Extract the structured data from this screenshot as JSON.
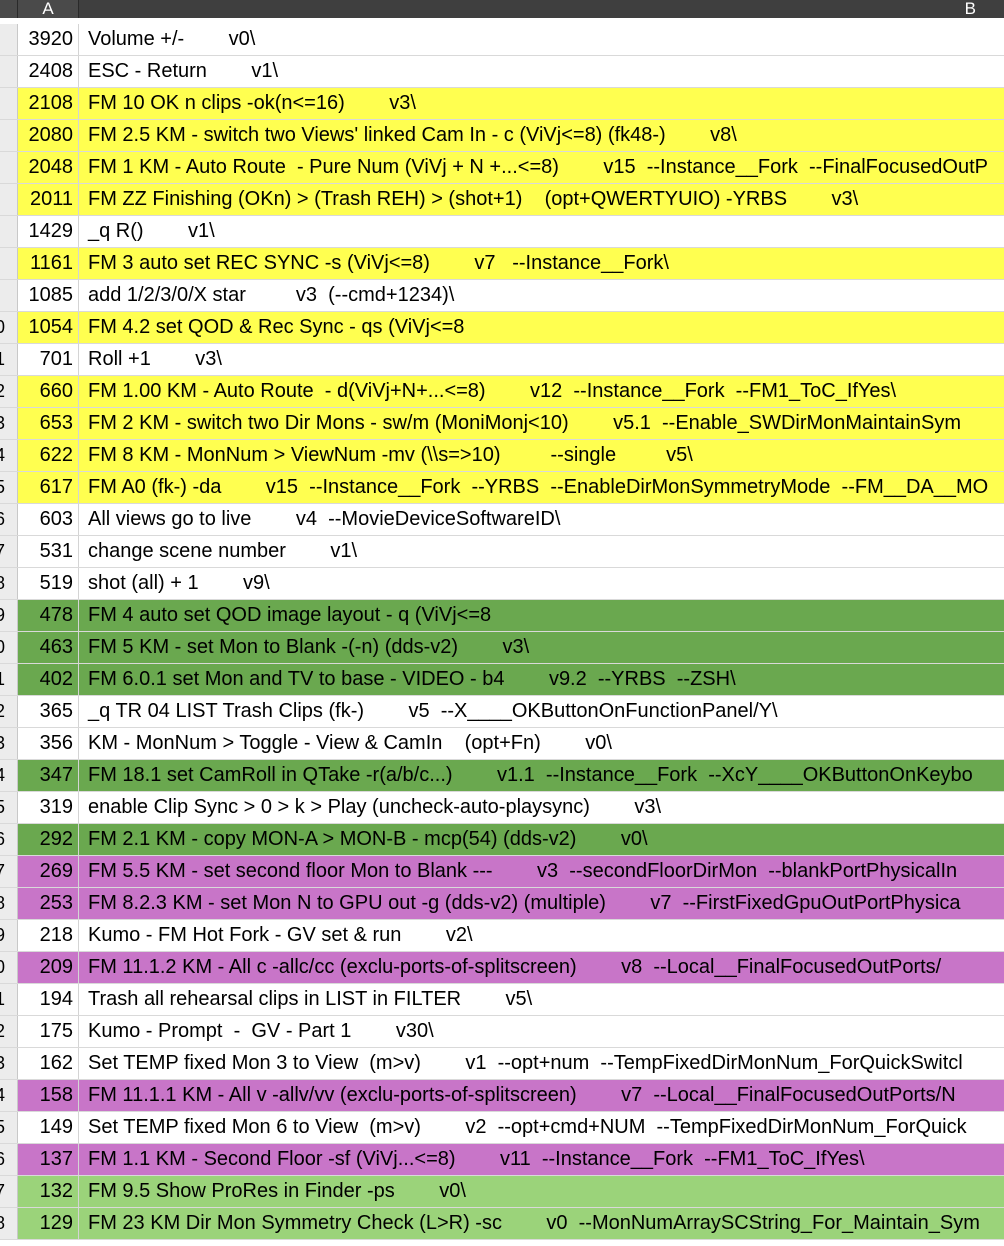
{
  "header": {
    "col_a": "A",
    "col_b": "B"
  },
  "colors": {
    "white": "#ffffff",
    "yellow": "#ffff50",
    "green": "#6aa84f",
    "pink": "#c875c8",
    "lightgreen": "#9bd37a"
  },
  "rows": [
    {
      "row": "",
      "num": "3920",
      "text": "Volume +/-        v0\\",
      "color": "white"
    },
    {
      "row": "",
      "num": "2408",
      "text": "ESC - Return        v1\\",
      "color": "white"
    },
    {
      "row": "",
      "num": "2108",
      "text": "FM 10 OK n clips -ok(n<=16)        v3\\",
      "color": "yellow"
    },
    {
      "row": "",
      "num": "2080",
      "text": "FM 2.5 KM - switch two Views' linked Cam In - c (ViVj<=8) (fk48-)        v8\\",
      "color": "yellow"
    },
    {
      "row": "",
      "num": "2048",
      "text": "FM 1 KM - Auto Route  - Pure Num (ViVj + N +...<=8)        v15  --Instance__Fork  --FinalFocusedOutP",
      "color": "yellow"
    },
    {
      "row": "",
      "num": "2011",
      "text": "FM ZZ Finishing (OKn) > (Trash REH) > (shot+1)    (opt+QWERTYUIO) -YRBS        v3\\",
      "color": "yellow"
    },
    {
      "row": "",
      "num": "1429",
      "text": "_q R()        v1\\",
      "color": "white"
    },
    {
      "row": "",
      "num": "1161",
      "text": "FM 3 auto set REC SYNC -s (ViVj<=8)        v7   --Instance__Fork\\",
      "color": "yellow"
    },
    {
      "row": "",
      "num": "1085",
      "text": "add 1/2/3/0/X star         v3  (--cmd+1234)\\",
      "color": "white"
    },
    {
      "row": "0",
      "num": "1054",
      "text": "FM 4.2 set QOD & Rec Sync - qs (ViVj<=8",
      "color": "yellow"
    },
    {
      "row": "1",
      "num": "701",
      "text": "Roll +1        v3\\",
      "color": "white"
    },
    {
      "row": "2",
      "num": "660",
      "text": "FM 1.00 KM - Auto Route  - d(ViVj+N+...<=8)        v12  --Instance__Fork  --FM1_ToC_IfYes\\",
      "color": "yellow"
    },
    {
      "row": "3",
      "num": "653",
      "text": "FM 2 KM - switch two Dir Mons - sw/m (MoniMonj<10)        v5.1  --Enable_SWDirMonMaintainSym",
      "color": "yellow"
    },
    {
      "row": "4",
      "num": "622",
      "text": "FM 8 KM - MonNum > ViewNum -mv (\\\\s=>10)         --single         v5\\",
      "color": "yellow"
    },
    {
      "row": "5",
      "num": "617",
      "text": "FM A0 (fk-) -da        v15  --Instance__Fork  --YRBS  --EnableDirMonSymmetryMode  --FM__DA__MO",
      "color": "yellow"
    },
    {
      "row": "6",
      "num": "603",
      "text": "All views go to live        v4  --MovieDeviceSoftwareID\\",
      "color": "white"
    },
    {
      "row": "7",
      "num": "531",
      "text": "change scene number        v1\\",
      "color": "white"
    },
    {
      "row": "8",
      "num": "519",
      "text": "shot (all) + 1        v9\\",
      "color": "white"
    },
    {
      "row": "9",
      "num": "478",
      "text": "FM 4 auto set QOD image layout - q (ViVj<=8",
      "color": "green"
    },
    {
      "row": "0",
      "num": "463",
      "text": "FM 5 KM - set Mon to Blank -(-n) (dds-v2)        v3\\",
      "color": "green"
    },
    {
      "row": "1",
      "num": "402",
      "text": "FM 6.0.1 set Mon and TV to base - VIDEO - b4        v9.2  --YRBS  --ZSH\\",
      "color": "green"
    },
    {
      "row": "2",
      "num": "365",
      "text": "_q TR 04 LIST Trash Clips (fk-)        v5  --X____OKButtonOnFunctionPanel/Y\\",
      "color": "white"
    },
    {
      "row": "3",
      "num": "356",
      "text": "KM - MonNum > Toggle - View & CamIn    (opt+Fn)        v0\\",
      "color": "white"
    },
    {
      "row": "4",
      "num": "347",
      "text": "FM 18.1 set CamRoll in QTake -r(a/b/c...)        v1.1  --Instance__Fork  --XcY____OKButtonOnKeybo",
      "color": "green"
    },
    {
      "row": "5",
      "num": "319",
      "text": "enable Clip Sync > 0 > k > Play (uncheck-auto-playsync)        v3\\",
      "color": "white"
    },
    {
      "row": "6",
      "num": "292",
      "text": "FM 2.1 KM - copy MON-A > MON-B - mcp(54) (dds-v2)        v0\\",
      "color": "green"
    },
    {
      "row": "7",
      "num": "269",
      "text": "FM 5.5 KM - set second floor Mon to Blank ---        v3  --secondFloorDirMon  --blankPortPhysicalIn",
      "color": "pink"
    },
    {
      "row": "8",
      "num": "253",
      "text": "FM 8.2.3 KM - set Mon N to GPU out -g (dds-v2) (multiple)        v7  --FirstFixedGpuOutPortPhysica",
      "color": "pink"
    },
    {
      "row": "9",
      "num": "218",
      "text": "Kumo - FM Hot Fork - GV set & run        v2\\",
      "color": "white"
    },
    {
      "row": "0",
      "num": "209",
      "text": "FM 11.1.2 KM - All c -allc/cc (exclu-ports-of-splitscreen)        v8  --Local__FinalFocusedOutPorts/",
      "color": "pink"
    },
    {
      "row": "1",
      "num": "194",
      "text": "Trash all rehearsal clips in LIST in FILTER        v5\\",
      "color": "white"
    },
    {
      "row": "2",
      "num": "175",
      "text": "Kumo - Prompt  -  GV - Part 1        v30\\",
      "color": "white"
    },
    {
      "row": "3",
      "num": "162",
      "text": "Set TEMP fixed Mon 3 to View  (m>v)        v1  --opt+num  --TempFixedDirMonNum_ForQuickSwitcl",
      "color": "white"
    },
    {
      "row": "4",
      "num": "158",
      "text": "FM 11.1.1 KM - All v -allv/vv (exclu-ports-of-splitscreen)        v7  --Local__FinalFocusedOutPorts/N",
      "color": "pink"
    },
    {
      "row": "5",
      "num": "149",
      "text": "Set TEMP fixed Mon 6 to View  (m>v)        v2  --opt+cmd+NUM  --TempFixedDirMonNum_ForQuick",
      "color": "white"
    },
    {
      "row": "6",
      "num": "137",
      "text": "FM 1.1 KM - Second Floor -sf (ViVj...<=8)        v11  --Instance__Fork  --FM1_ToC_IfYes\\",
      "color": "pink"
    },
    {
      "row": "7",
      "num": "132",
      "text": "FM 9.5 Show ProRes in Finder -ps        v0\\",
      "color": "lightgreen"
    },
    {
      "row": "8",
      "num": "129",
      "text": "FM 23 KM Dir Mon Symmetry Check (L>R) -sc        v0  --MonNumArraySCString_For_Maintain_Sym",
      "color": "lightgreen"
    }
  ]
}
